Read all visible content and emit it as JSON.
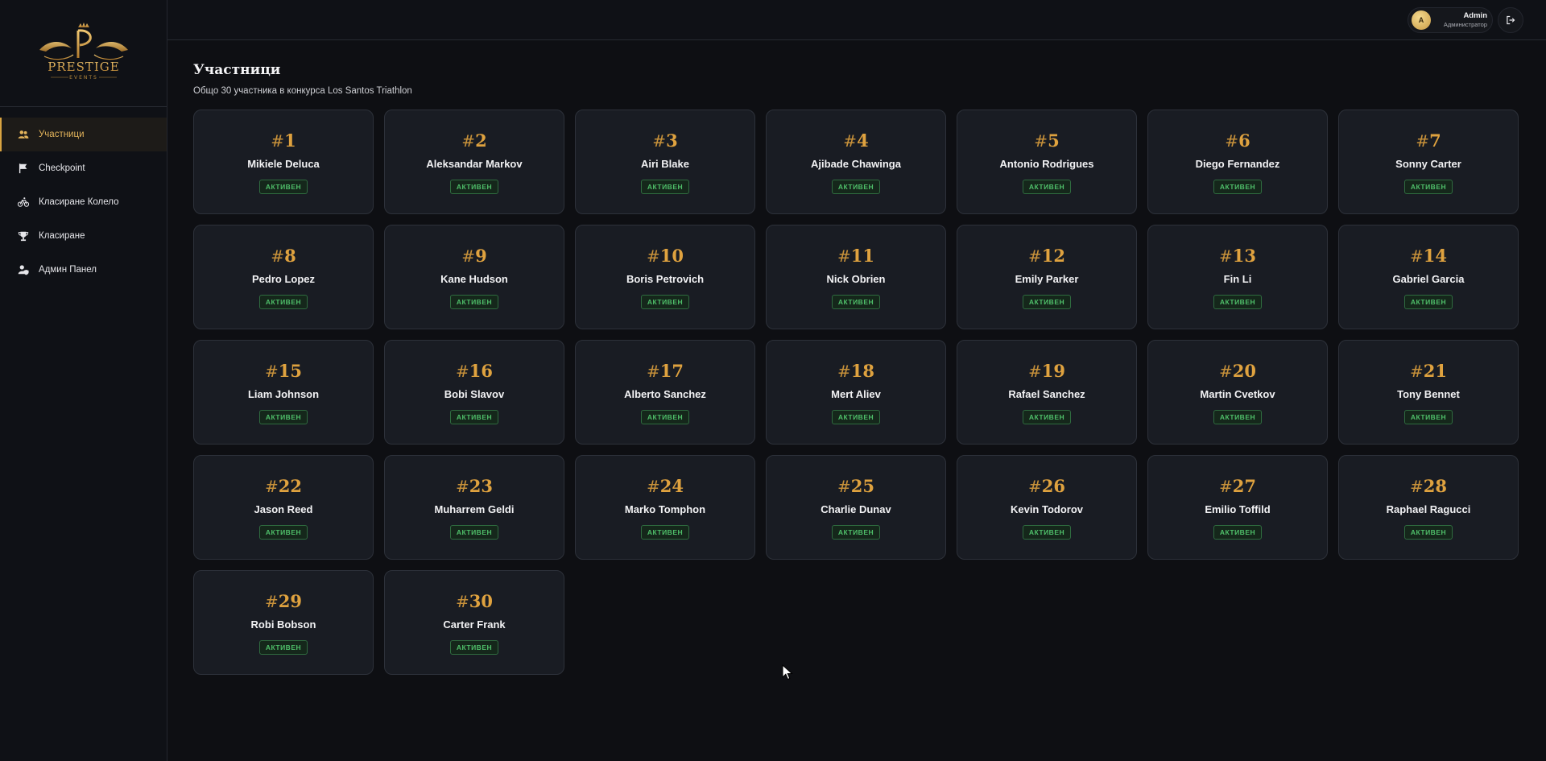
{
  "sidebar": {
    "brand": "PRESTIGE",
    "brand_sub": "EVENTS",
    "items": [
      {
        "label": "Участници",
        "icon": "users-icon",
        "active": true
      },
      {
        "label": "Checkpoint",
        "icon": "flag-icon",
        "active": false
      },
      {
        "label": "Класиране Колело",
        "icon": "bicycle-icon",
        "active": false
      },
      {
        "label": "Класиране",
        "icon": "trophy-icon",
        "active": false
      },
      {
        "label": "Админ Панел",
        "icon": "admin-shield-icon",
        "active": false
      }
    ]
  },
  "header": {
    "user_initial": "A",
    "user_name": "Admin",
    "user_role": "Администратор",
    "logout_icon": "logout-icon"
  },
  "main": {
    "title": "Участници",
    "subtitle": "Общо 30 участника в конкурса Los Santos Triathlon"
  },
  "participants": [
    {
      "hash": "#",
      "number": "1",
      "name": "Mikiele Deluca",
      "status": "АКТИВЕН"
    },
    {
      "hash": "#",
      "number": "2",
      "name": "Aleksandar Markov",
      "status": "АКТИВЕН"
    },
    {
      "hash": "#",
      "number": "3",
      "name": "Airi Blake",
      "status": "АКТИВЕН"
    },
    {
      "hash": "#",
      "number": "4",
      "name": "Ajibade Chawinga",
      "status": "АКТИВЕН"
    },
    {
      "hash": "#",
      "number": "5",
      "name": "Antonio Rodrigues",
      "status": "АКТИВЕН"
    },
    {
      "hash": "#",
      "number": "6",
      "name": "Diego Fernandez",
      "status": "АКТИВЕН"
    },
    {
      "hash": "#",
      "number": "7",
      "name": "Sonny Carter",
      "status": "АКТИВЕН"
    },
    {
      "hash": "#",
      "number": "8",
      "name": "Pedro Lopez",
      "status": "АКТИВЕН"
    },
    {
      "hash": "#",
      "number": "9",
      "name": "Kane Hudson",
      "status": "АКТИВЕН"
    },
    {
      "hash": "#",
      "number": "10",
      "name": "Boris Petrovich",
      "status": "АКТИВЕН"
    },
    {
      "hash": "#",
      "number": "11",
      "name": "Nick Obrien",
      "status": "АКТИВЕН"
    },
    {
      "hash": "#",
      "number": "12",
      "name": "Emily Parker",
      "status": "АКТИВЕН"
    },
    {
      "hash": "#",
      "number": "13",
      "name": "Fin Li",
      "status": "АКТИВЕН"
    },
    {
      "hash": "#",
      "number": "14",
      "name": "Gabriel Garcia",
      "status": "АКТИВЕН"
    },
    {
      "hash": "#",
      "number": "15",
      "name": "Liam Johnson",
      "status": "АКТИВЕН"
    },
    {
      "hash": "#",
      "number": "16",
      "name": "Bobi Slavov",
      "status": "АКТИВЕН"
    },
    {
      "hash": "#",
      "number": "17",
      "name": "Alberto Sanchez",
      "status": "АКТИВЕН"
    },
    {
      "hash": "#",
      "number": "18",
      "name": "Mert Aliev",
      "status": "АКТИВЕН"
    },
    {
      "hash": "#",
      "number": "19",
      "name": "Rafael Sanchez",
      "status": "АКТИВЕН"
    },
    {
      "hash": "#",
      "number": "20",
      "name": "Martin Cvetkov",
      "status": "АКТИВЕН"
    },
    {
      "hash": "#",
      "number": "21",
      "name": "Tony Bennet",
      "status": "АКТИВЕН"
    },
    {
      "hash": "#",
      "number": "22",
      "name": "Jason Reed",
      "status": "АКТИВЕН"
    },
    {
      "hash": "#",
      "number": "23",
      "name": "Muharrem Geldi",
      "status": "АКТИВЕН"
    },
    {
      "hash": "#",
      "number": "24",
      "name": "Marko Tomphon",
      "status": "АКТИВЕН"
    },
    {
      "hash": "#",
      "number": "25",
      "name": "Charlie Dunav",
      "status": "АКТИВЕН"
    },
    {
      "hash": "#",
      "number": "26",
      "name": "Kevin Todorov",
      "status": "АКТИВЕН"
    },
    {
      "hash": "#",
      "number": "27",
      "name": "Emilio Toffild",
      "status": "АКТИВЕН"
    },
    {
      "hash": "#",
      "number": "28",
      "name": "Raphael Ragucci",
      "status": "АКТИВЕН"
    },
    {
      "hash": "#",
      "number": "29",
      "name": "Robi Bobson",
      "status": "АКТИВЕН"
    },
    {
      "hash": "#",
      "number": "30",
      "name": "Carter Frank",
      "status": "АКТИВЕН"
    }
  ],
  "colors": {
    "accent_gold": "#dfa23f",
    "status_green": "#4fbf6a",
    "background": "#0e0f13",
    "card": "#191c23"
  }
}
